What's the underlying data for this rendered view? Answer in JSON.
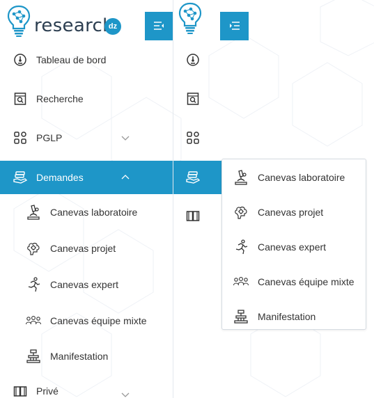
{
  "brand": {
    "name": "research",
    "badge": "dz"
  },
  "colors": {
    "accent": "#1e96c8",
    "text": "#333333",
    "border": "#d5dbe1"
  },
  "sidebar": {
    "items": [
      {
        "label": "Tableau de bord",
        "icon": "dashboard-gauge-icon"
      },
      {
        "label": "Recherche",
        "icon": "search-document-icon"
      },
      {
        "label": "PGLP",
        "icon": "apps-grid-icon",
        "expanded": false
      },
      {
        "label": "Demandes",
        "icon": "hand-stack-icon",
        "expanded": true,
        "active": true
      },
      {
        "label": "Privé",
        "icon": "book-icon",
        "expanded": false
      }
    ],
    "demandes_children": [
      {
        "label": "Canevas laboratoire",
        "icon": "microscope-icon"
      },
      {
        "label": "Canevas projet",
        "icon": "brain-gear-icon"
      },
      {
        "label": "Canevas expert",
        "icon": "runner-icon"
      },
      {
        "label": "Canevas équipe mixte",
        "icon": "team-icon"
      },
      {
        "label": "Manifestation",
        "icon": "fountain-icon"
      }
    ]
  },
  "popup": {
    "items": [
      {
        "label": "Canevas laboratoire",
        "icon": "microscope-icon"
      },
      {
        "label": "Canevas projet",
        "icon": "brain-gear-icon"
      },
      {
        "label": "Canevas expert",
        "icon": "runner-icon"
      },
      {
        "label": "Canevas équipe mixte",
        "icon": "team-icon"
      },
      {
        "label": "Manifestation",
        "icon": "fountain-icon"
      }
    ]
  }
}
